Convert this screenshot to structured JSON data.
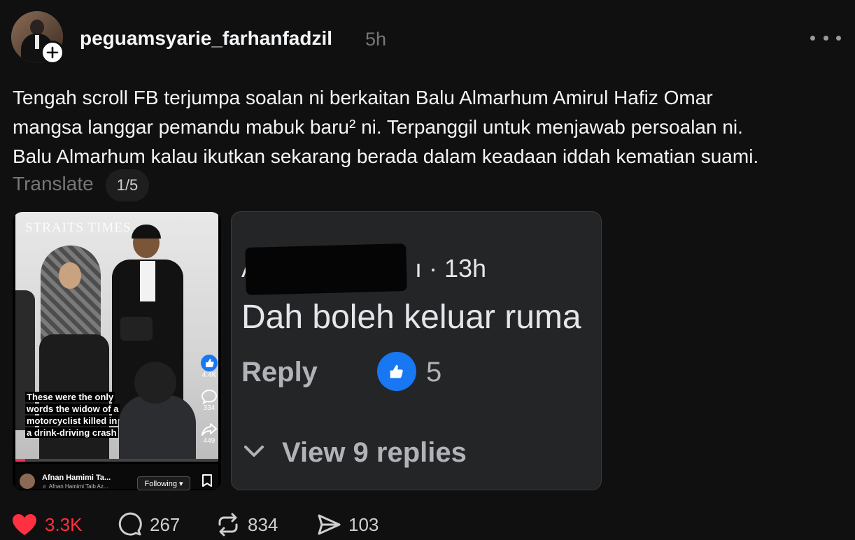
{
  "post": {
    "username": "peguamsyarie_farhanfadzil",
    "time": "5h",
    "text_lines": [
      "Tengah scroll FB terjumpa soalan ni berkaitan Balu Almarhum Amirul Hafiz Omar",
      "mangsa langgar pemandu mabuk baru² ni. Terpanggil untuk menjawab persoalan ni.",
      "Balu Almarhum kalau ikutkan sekarang berada dalam keadaan iddah kematian suami."
    ],
    "translate_label": "Translate",
    "page_indicator": "1/5"
  },
  "media1": {
    "watermark": "STRAITS TIMES",
    "caption_lines": [
      "These were the only",
      "words the widow of a",
      "motorcyclist killed in",
      "a drink-driving crash"
    ],
    "likes": "4.4K",
    "comments": "334",
    "shares": "449",
    "author": "Afnan Hamimi Ta...",
    "music": "♬ Afnan Hamimi Taib Az...",
    "follow_label": "Following ▾"
  },
  "media2": {
    "commenter_initial": "A",
    "time": "ı · 13h",
    "comment_text": "Dah boleh keluar ruma",
    "reply_label": "Reply",
    "likes": "5",
    "view_replies": "View 9 replies"
  },
  "actions": {
    "likes": "3.3K",
    "comments": "267",
    "reposts": "834",
    "shares": "103"
  },
  "colors": {
    "background": "#101010",
    "like_red": "#ff3040",
    "fb_blue": "#1877f2"
  },
  "icons": [
    "plus-icon",
    "more-icon",
    "thumbs-up-icon",
    "comment-icon",
    "share-icon",
    "bookmark-icon",
    "chevron-down-icon",
    "heart-icon",
    "repost-icon",
    "send-icon"
  ]
}
